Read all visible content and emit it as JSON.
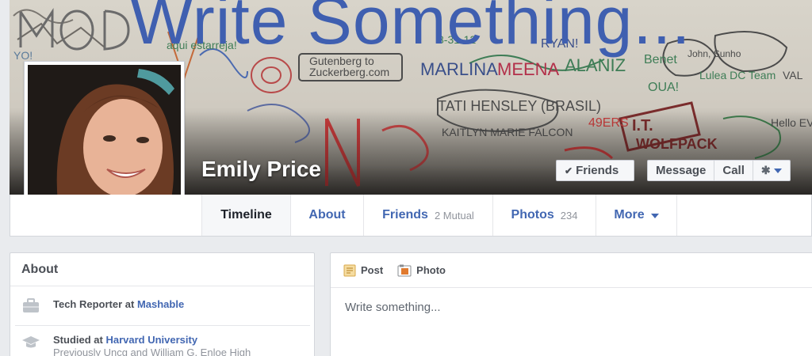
{
  "cover": {
    "headline": "Write Something..."
  },
  "profile": {
    "name": "Emily Price"
  },
  "actions": {
    "friends_label": "Friends",
    "message_label": "Message",
    "call_label": "Call"
  },
  "nav": {
    "tabs": [
      {
        "label": "Timeline",
        "sub": ""
      },
      {
        "label": "About",
        "sub": ""
      },
      {
        "label": "Friends",
        "sub": "2 Mutual"
      },
      {
        "label": "Photos",
        "sub": "234"
      },
      {
        "label": "More",
        "sub": ""
      }
    ]
  },
  "about": {
    "title": "About",
    "work_prefix": "Tech Reporter at ",
    "work_link": "Mashable",
    "edu_prefix": "Studied at ",
    "edu_link": "Harvard University",
    "edu_secondary": "Previously Uncg and William G. Enloe High"
  },
  "composer": {
    "post_label": "Post",
    "photo_label": "Photo",
    "placeholder": "Write something..."
  },
  "colors": {
    "brand_blue": "#4267b2",
    "background": "#e9ebee"
  }
}
